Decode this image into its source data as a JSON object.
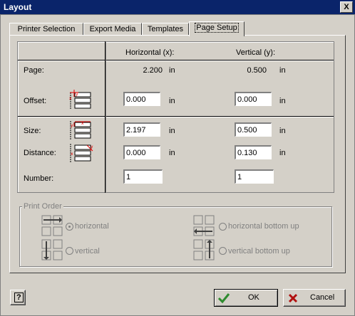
{
  "window": {
    "title": "Layout",
    "close_glyph": "X"
  },
  "tabs": [
    {
      "label": "Printer Selection"
    },
    {
      "label": "Export Media"
    },
    {
      "label": "Templates"
    },
    {
      "label": "Page Setup",
      "active": true
    }
  ],
  "columns": {
    "horizontal": "Horizontal (x):",
    "vertical": "Vertical (y):"
  },
  "rows": {
    "page": {
      "label": "Page:",
      "x": "2.200",
      "x_unit": "in",
      "y": "0.500",
      "y_unit": "in"
    },
    "offset": {
      "label": "Offset:",
      "x": "0.000",
      "x_unit": "in",
      "y": "0.000",
      "y_unit": "in"
    },
    "size": {
      "label": "Size:",
      "x": "2.197",
      "x_unit": "in",
      "y": "0.500",
      "y_unit": "in"
    },
    "distance": {
      "label": "Distance:",
      "x": "0.000",
      "x_unit": "in",
      "y": "0.130",
      "y_unit": "in"
    },
    "number": {
      "label": "Number:",
      "x": "1",
      "y": "1"
    }
  },
  "print_order": {
    "title": "Print Order",
    "options": [
      {
        "label": "horizontal",
        "selected": true
      },
      {
        "label": "horizontal bottom up",
        "selected": false
      },
      {
        "label": "vertical",
        "selected": false
      },
      {
        "label": "vertical bottom up",
        "selected": false
      }
    ]
  },
  "buttons": {
    "help": "?",
    "ok": "OK",
    "cancel": "Cancel"
  },
  "colors": {
    "title_bar": "#0a246a",
    "face": "#d4d0c8",
    "ok_check": "#2e8b2e",
    "cancel_x": "#b01010",
    "diagram_red": "#e00000"
  }
}
